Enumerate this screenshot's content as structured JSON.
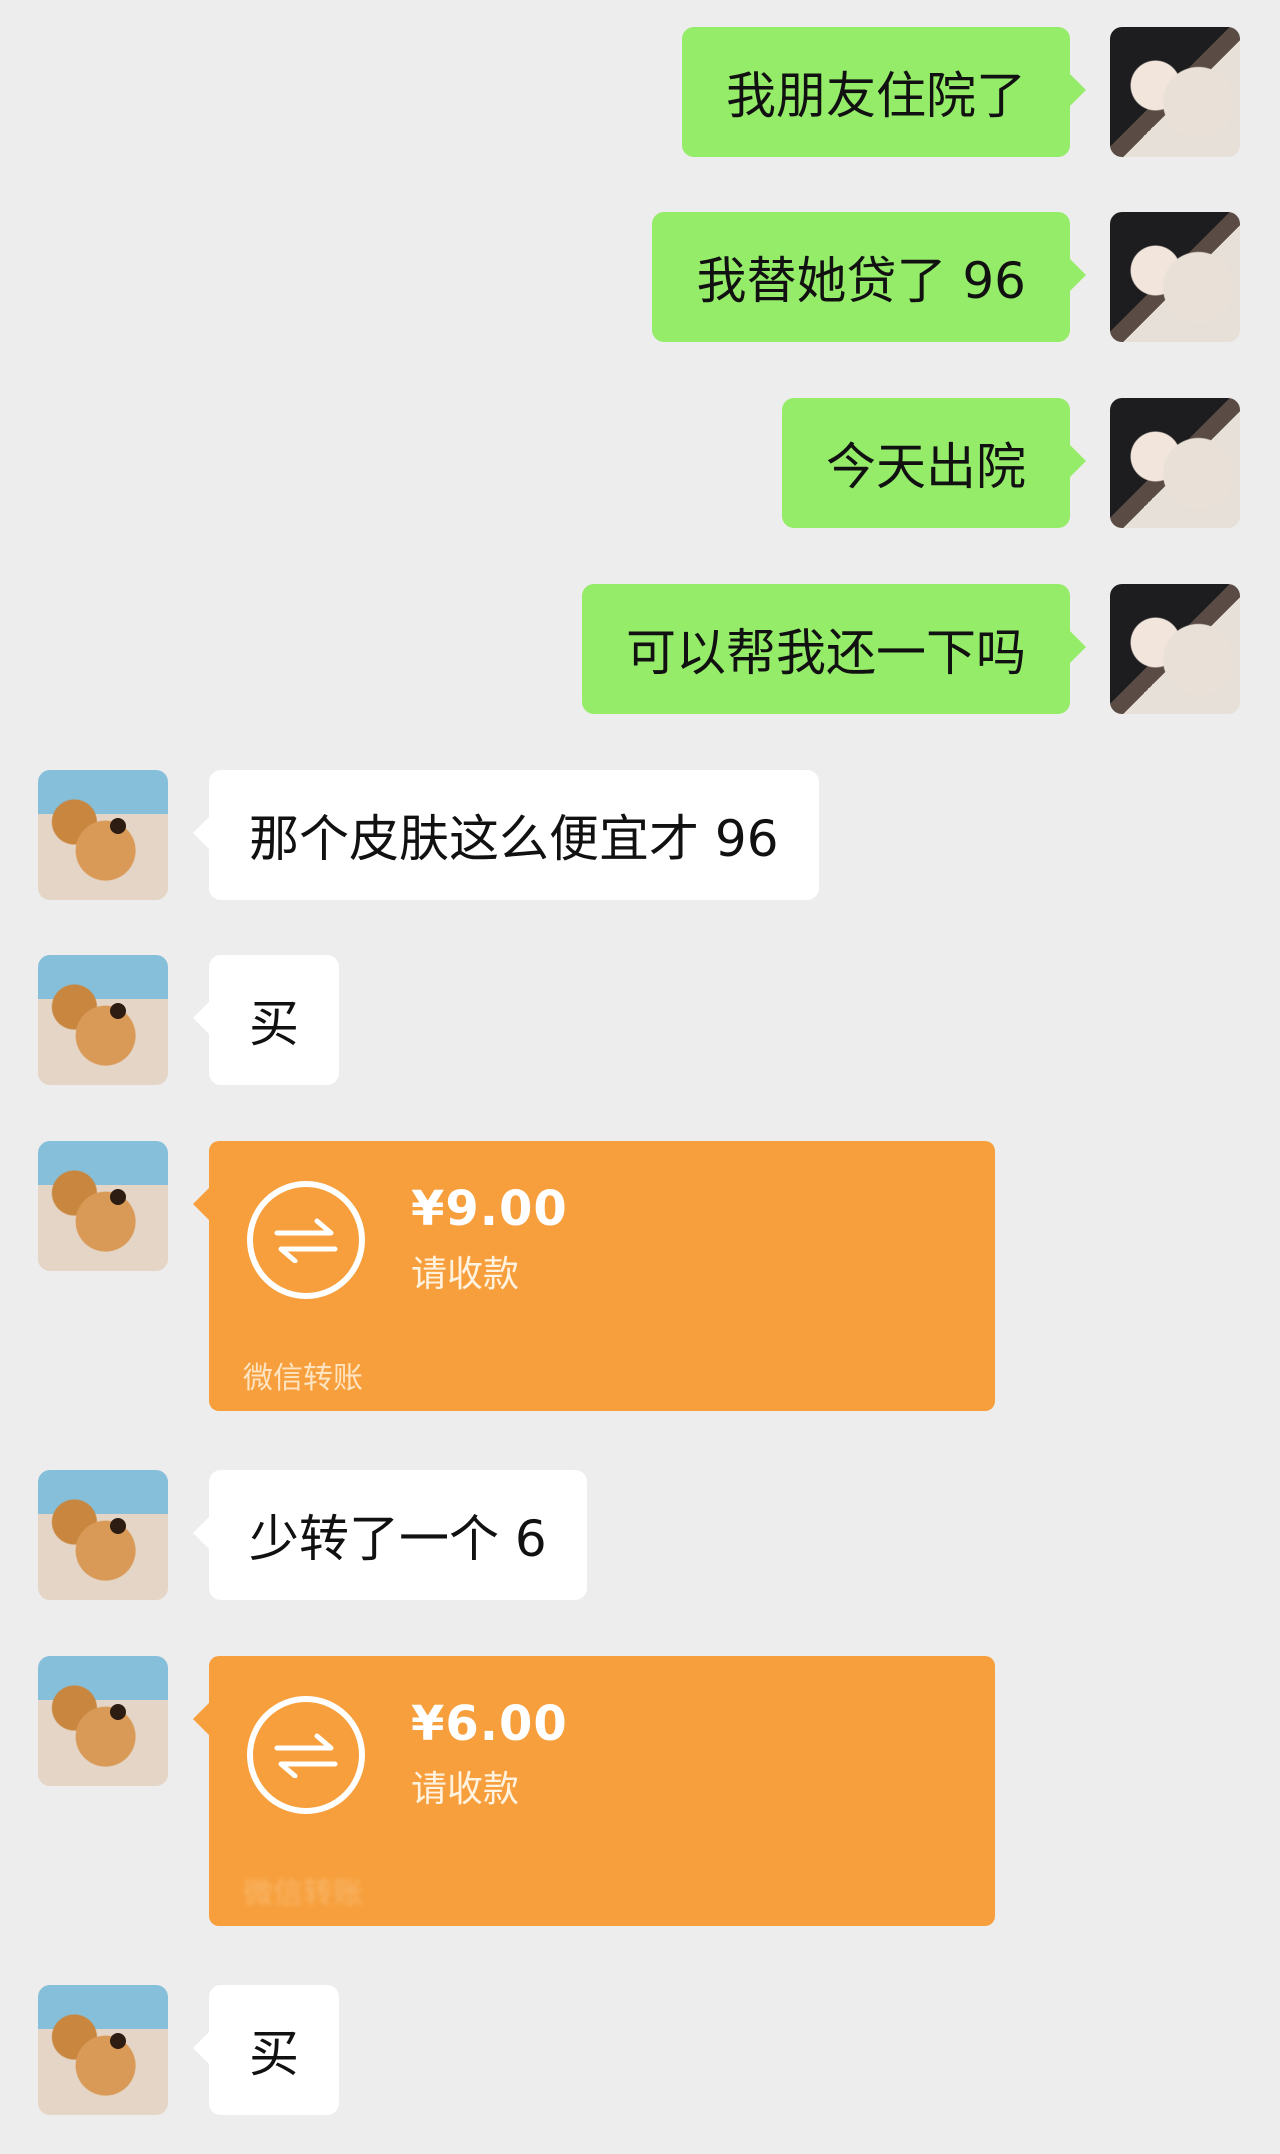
{
  "messages": {
    "m1": "我朋友住院了",
    "m2": "我替她贷了 96",
    "m3": "今天出院",
    "m4": "可以帮我还一下吗",
    "r1": "那个皮肤这么便宜才 96",
    "r2": "买",
    "r3": "少转了一个 6",
    "r4": "买"
  },
  "transfers": {
    "t1": {
      "amount": "¥9.00",
      "status": "请收款",
      "footer": "微信转账"
    },
    "t2": {
      "amount": "¥6.00",
      "status": "请收款",
      "footer": "微信转账"
    }
  },
  "colors": {
    "bg": "#ededed",
    "me_bubble": "#95ec69",
    "them_bubble": "#ffffff",
    "transfer": "#f79f3c"
  },
  "icons": {
    "transfer": "transfer-arrows-icon"
  }
}
